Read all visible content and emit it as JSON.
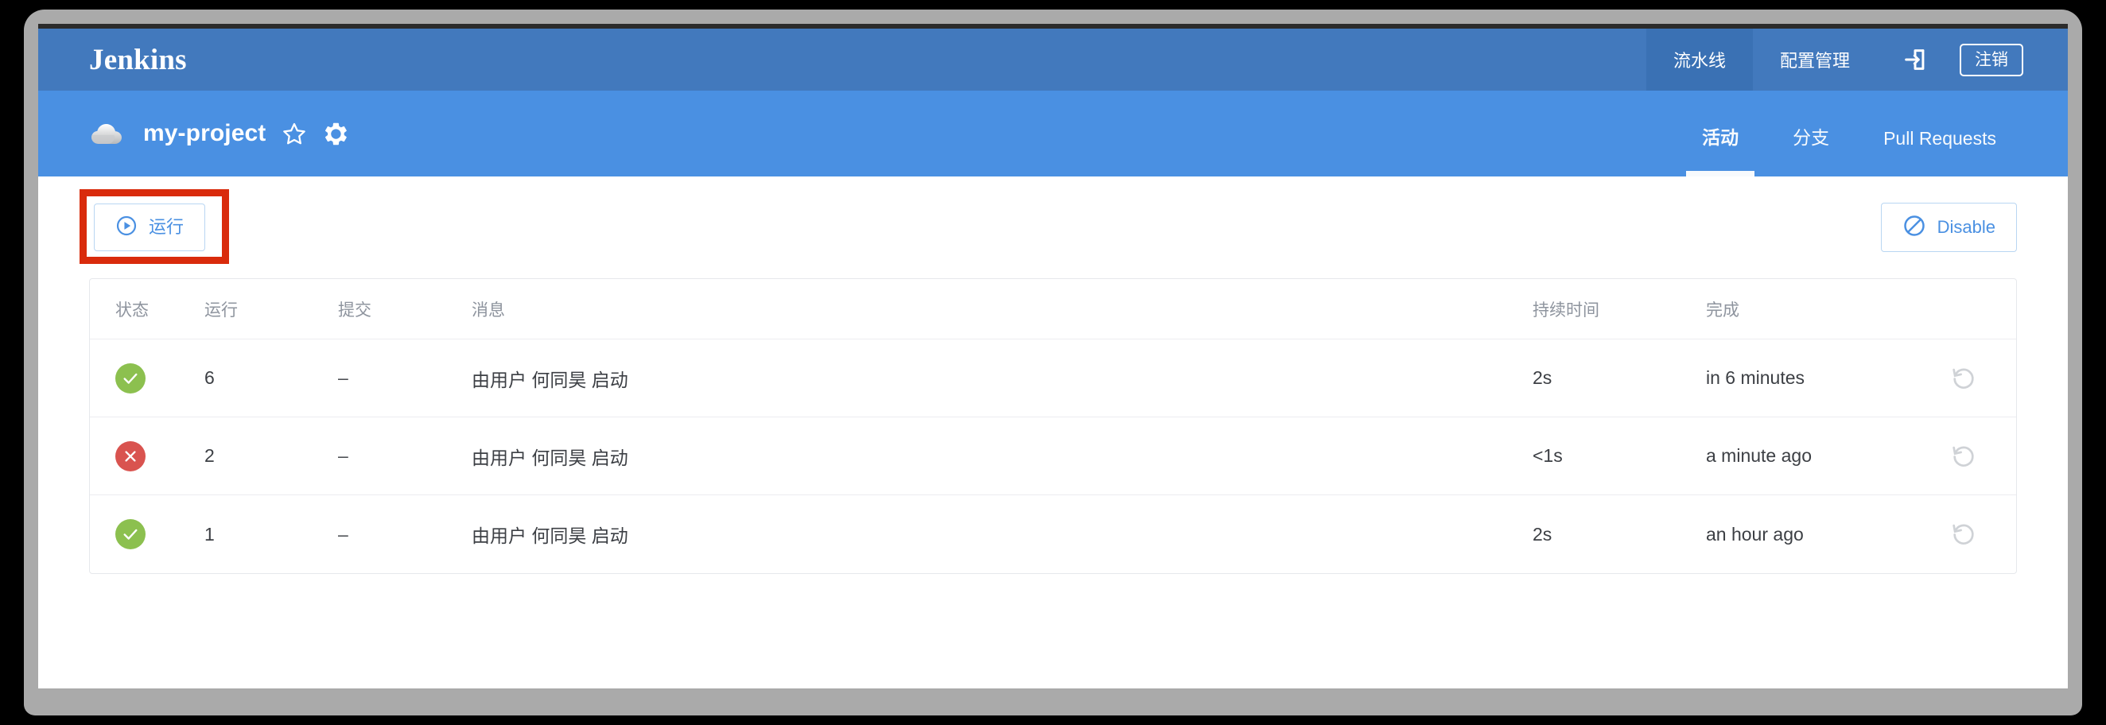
{
  "header": {
    "logo": "Jenkins",
    "nav": [
      {
        "label": "流水线",
        "active": true
      },
      {
        "label": "配置管理",
        "active": false
      }
    ],
    "login_icon": "login-arrow-icon",
    "logout_label": "注销"
  },
  "project": {
    "cloud_icon": "cloud-icon",
    "name": "my-project",
    "favorite_icon": "star-outline-icon",
    "settings_icon": "gear-icon",
    "tabs": [
      {
        "label": "活动",
        "active": true
      },
      {
        "label": "分支",
        "active": false
      },
      {
        "label": "Pull Requests",
        "active": false
      }
    ]
  },
  "toolbar": {
    "run_label": "运行",
    "run_icon": "play-circle-icon",
    "disable_label": "Disable",
    "disable_icon": "no-entry-icon",
    "highlight_color": "#d92b0c"
  },
  "table": {
    "columns": {
      "status": "状态",
      "run": "运行",
      "commit": "提交",
      "message": "消息",
      "duration": "持续时间",
      "completed": "完成"
    },
    "rows": [
      {
        "status": "success",
        "run": "6",
        "commit": "–",
        "message": "由用户 何同昊 启动",
        "duration": "2s",
        "completed": "in 6 minutes",
        "replay_icon": "replay-icon"
      },
      {
        "status": "failure",
        "run": "2",
        "commit": "–",
        "message": "由用户 何同昊 启动",
        "duration": "<1s",
        "completed": "a minute ago",
        "replay_icon": "replay-icon"
      },
      {
        "status": "success",
        "run": "1",
        "commit": "–",
        "message": "由用户 何同昊 启动",
        "duration": "2s",
        "completed": "an hour ago",
        "replay_icon": "replay-icon"
      }
    ]
  },
  "colors": {
    "header_blue": "#4279bd",
    "project_blue": "#4a90e2",
    "active_tab_blue": "#3a71b4",
    "accent_blue": "#4a90e2",
    "success_green": "#8cc04f",
    "failure_red": "#d9534f"
  }
}
